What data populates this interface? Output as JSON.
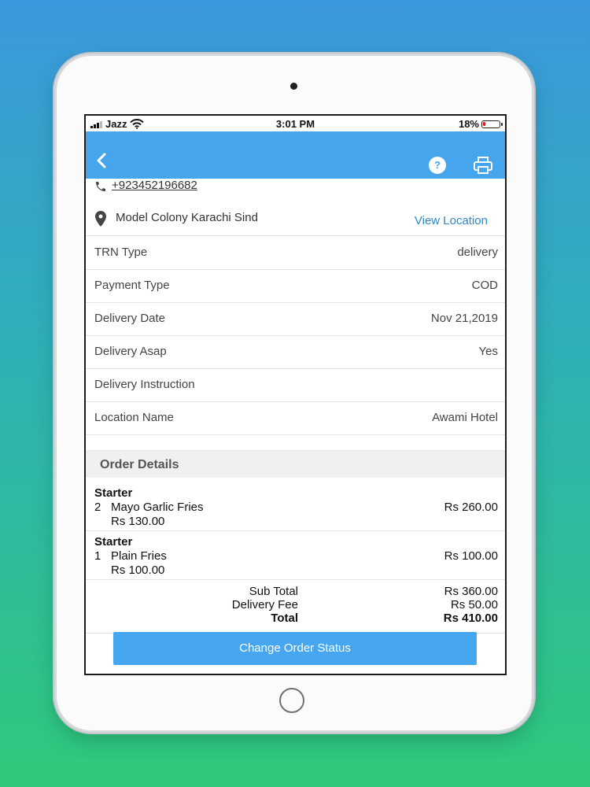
{
  "status_bar": {
    "carrier": "Jazz",
    "time": "3:01 PM",
    "battery": "18%",
    "battery_level": 0.18
  },
  "nav": {
    "back_icon": "chevron-left-icon",
    "help_icon": "question-circle-icon",
    "help_symbol": "?",
    "print_icon": "printer-icon",
    "color": "#45a6ee"
  },
  "contact": {
    "phone": "+923452196682",
    "address": "Model Colony Karachi Sind",
    "view_location": "View Location"
  },
  "info": [
    {
      "label": "TRN Type",
      "value": "delivery"
    },
    {
      "label": "Payment Type",
      "value": "COD"
    },
    {
      "label": "Delivery Date",
      "value": "Nov 21,2019"
    },
    {
      "label": "Delivery Asap",
      "value": "Yes"
    },
    {
      "label": "Delivery Instruction",
      "value": ""
    },
    {
      "label": "Location Name",
      "value": "Awami Hotel"
    }
  ],
  "order": {
    "header": "Order Details",
    "items": [
      {
        "category": "Starter",
        "qty": "2",
        "name": "Mayo Garlic Fries",
        "unit_price": "Rs 130.00",
        "total": "Rs 260.00"
      },
      {
        "category": "Starter",
        "qty": "1",
        "name": "Plain Fries",
        "unit_price": "Rs 100.00",
        "total": "Rs 100.00"
      }
    ],
    "sub_total_label": "Sub Total",
    "sub_total": "Rs 360.00",
    "delivery_fee_label": "Delivery Fee",
    "delivery_fee": "Rs 50.00",
    "total_label": "Total",
    "total": "Rs 410.00"
  },
  "actions": {
    "change_status": "Change Order Status"
  }
}
